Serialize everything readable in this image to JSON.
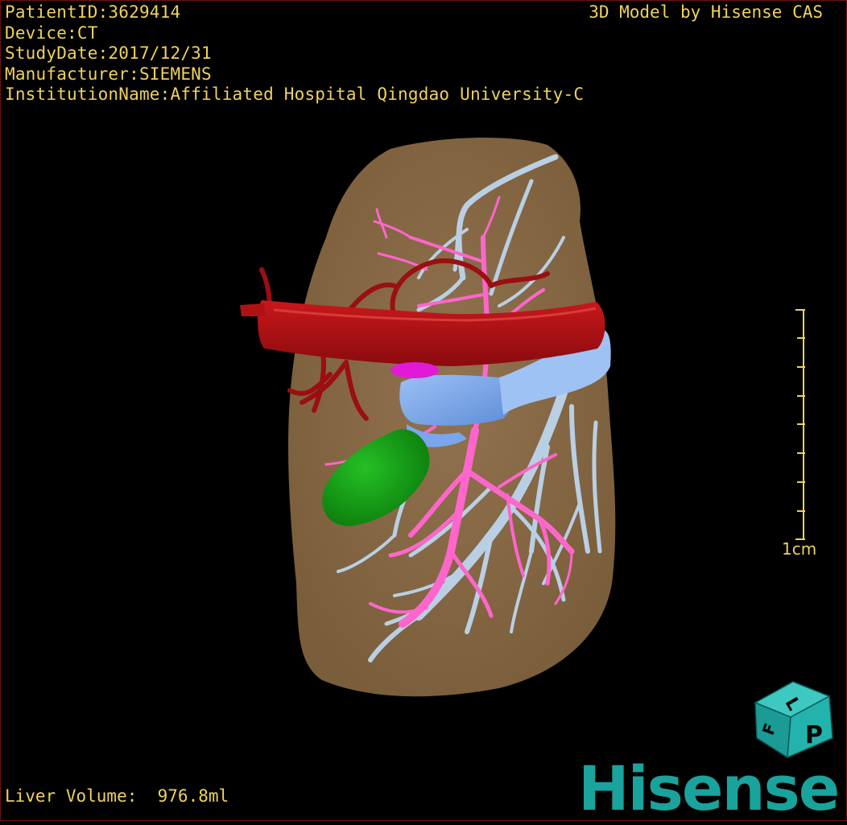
{
  "patient_info": {
    "patient_id": "PatientID:3629414",
    "device": "Device:CT",
    "study_date": "StudyDate:2017/12/31",
    "manufacturer": "Manufacturer:SIEMENS",
    "institution": "InstitutionName:Affiliated Hospital Qingdao University-C"
  },
  "credit": "3D Model by Hisense CAS",
  "liver_volume": "Liver Volume:  976.8ml",
  "scale_bar": {
    "label": "1cm"
  },
  "orientation_cube": {
    "face_top": "L",
    "face_right": "P",
    "face_left": "F"
  },
  "logo": "Hisense",
  "colors": {
    "text": "#f0d25a",
    "liver": "#8a6c45",
    "artery": "#b01214",
    "portal_vein": "#ff66cc",
    "hepatic_vein": "#b9cfe4",
    "ivc": "#84aef0",
    "gallbladder": "#14a014",
    "logo": "#19a39c"
  }
}
